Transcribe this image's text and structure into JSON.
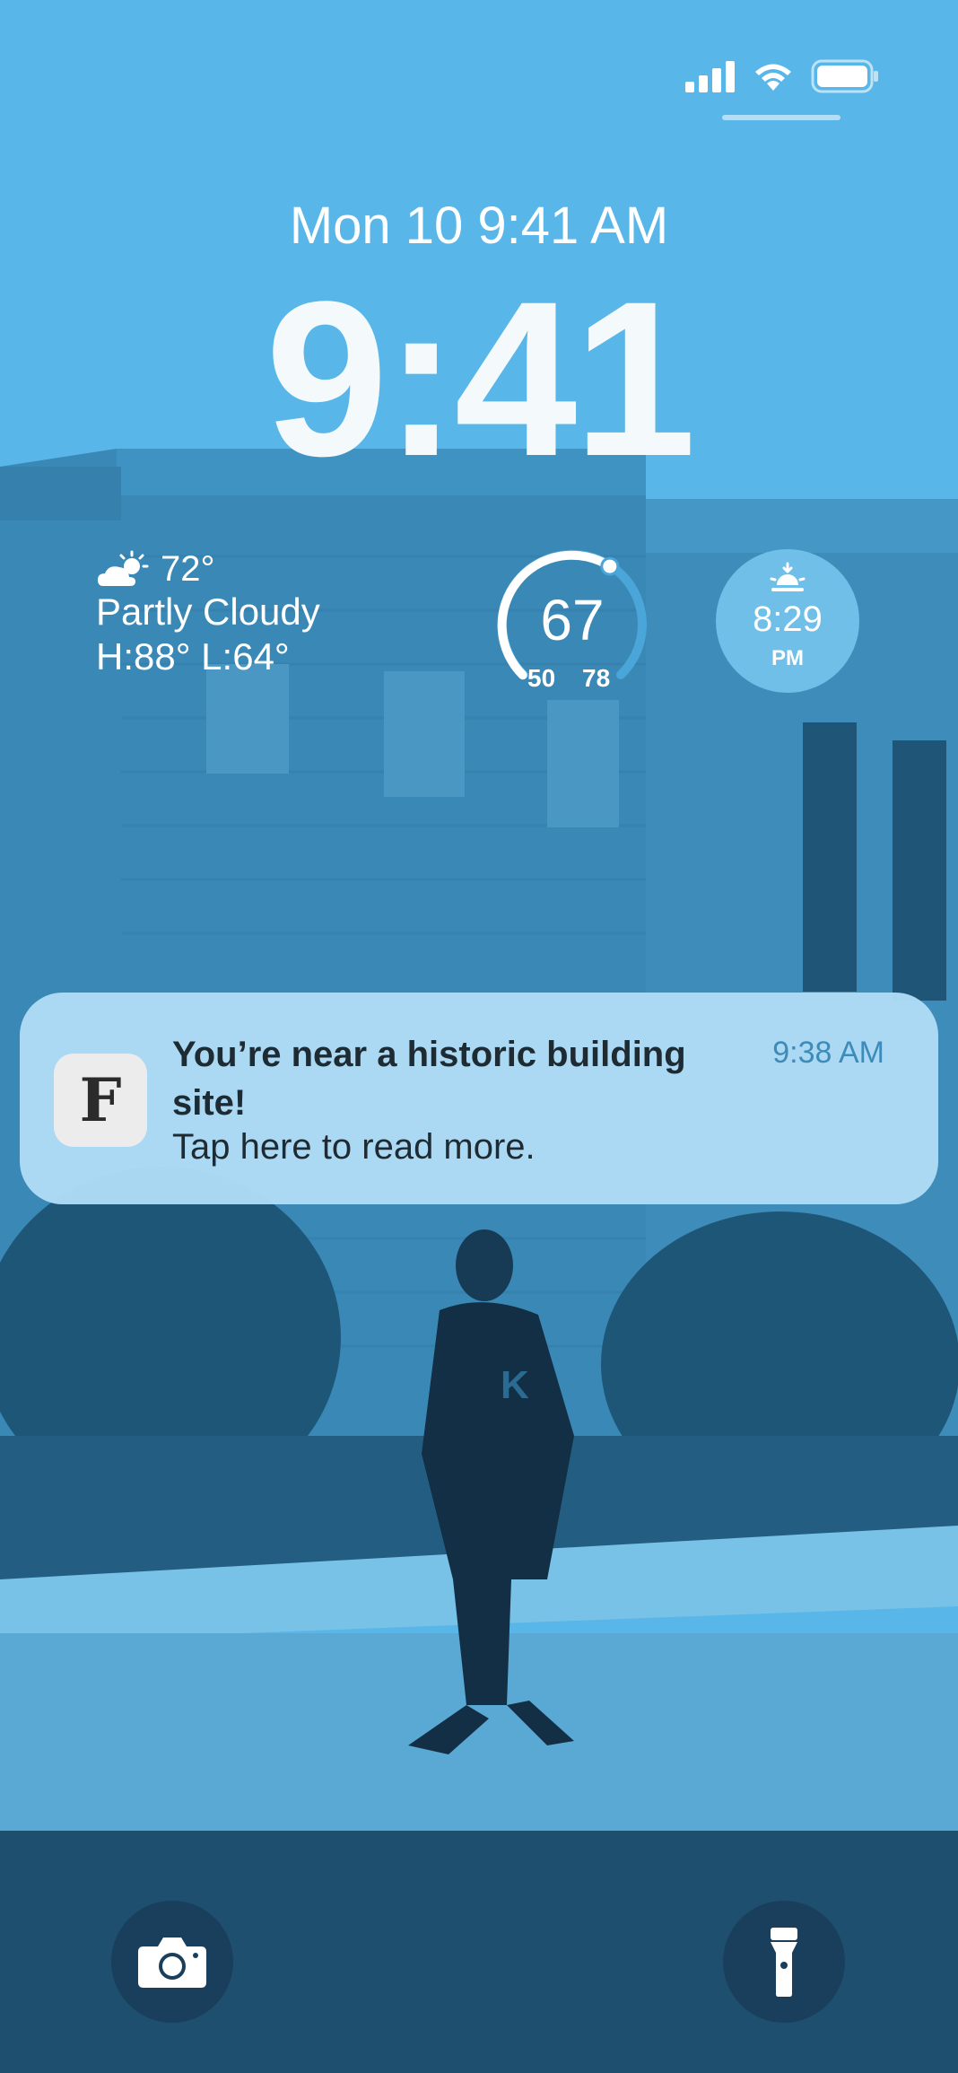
{
  "status_bar": {
    "signal_icon": "cellular-signal-icon",
    "wifi_icon": "wifi-icon",
    "battery_icon": "battery-icon"
  },
  "lock_screen": {
    "date": "Mon 10 9:41 AM",
    "time": "9:41"
  },
  "weather": {
    "icon": "partly-cloudy-icon",
    "temperature": "72°",
    "condition": "Partly Cloudy",
    "high_low": "H:88° L:64°"
  },
  "temp_gauge": {
    "current": "67",
    "low": "50",
    "high": "78",
    "level": 0.62
  },
  "sunset": {
    "icon": "sunset-icon",
    "time": "8:29",
    "ampm": "PM"
  },
  "notification": {
    "app_icon_letter": "F",
    "title": "You’re near a historic building site!",
    "body": "Tap here to read more.",
    "time": "9:38 AM"
  },
  "quick_actions": {
    "left_icon": "camera-icon",
    "right_icon": "flashlight-icon"
  },
  "colors": {
    "tint": "#58b6e8",
    "dark": "#193f5c",
    "notification": "#b2def8",
    "accent_text": "#3d8bb8"
  }
}
